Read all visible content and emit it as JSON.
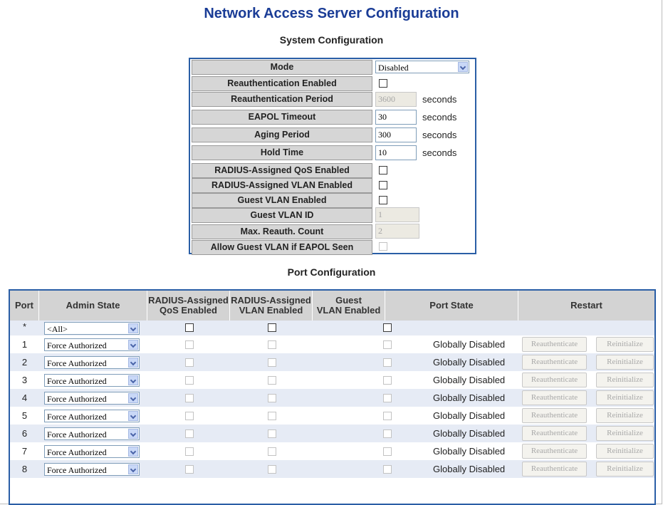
{
  "page_title": "Network Access Server Configuration",
  "system": {
    "title": "System Configuration",
    "rows": [
      {
        "label": "Mode",
        "value": "Disabled"
      },
      {
        "label": "Reauthentication Enabled"
      },
      {
        "label": "Reauthentication Period",
        "value": "3600",
        "unit": "seconds"
      },
      {
        "label": "EAPOL Timeout",
        "value": "30",
        "unit": "seconds"
      },
      {
        "label": "Aging Period",
        "value": "300",
        "unit": "seconds"
      },
      {
        "label": "Hold Time",
        "value": "10",
        "unit": "seconds"
      },
      {
        "label": "RADIUS-Assigned QoS Enabled"
      },
      {
        "label": "RADIUS-Assigned VLAN Enabled"
      },
      {
        "label": "Guest VLAN Enabled"
      },
      {
        "label": "Guest VLAN ID",
        "value": "1"
      },
      {
        "label": "Max. Reauth. Count",
        "value": "2"
      },
      {
        "label": "Allow Guest VLAN if EAPOL Seen"
      }
    ]
  },
  "port": {
    "title": "Port Configuration",
    "headers": {
      "port": "Port",
      "admin": "Admin State",
      "qos_1": "RADIUS-Assigned",
      "qos_2": "QoS Enabled",
      "vlan_1": "RADIUS-Assigned",
      "vlan_2": "VLAN Enabled",
      "guest_1": "Guest",
      "guest_2": "VLAN Enabled",
      "state": "Port State",
      "restart": "Restart"
    },
    "all_row": {
      "port": "*",
      "admin": "<All>"
    },
    "rows": [
      {
        "port": "1",
        "admin": "Force Authorized",
        "state": "Globally Disabled",
        "reauth": "Reauthenticate",
        "reinit": "Reinitialize"
      },
      {
        "port": "2",
        "admin": "Force Authorized",
        "state": "Globally Disabled",
        "reauth": "Reauthenticate",
        "reinit": "Reinitialize"
      },
      {
        "port": "3",
        "admin": "Force Authorized",
        "state": "Globally Disabled",
        "reauth": "Reauthenticate",
        "reinit": "Reinitialize"
      },
      {
        "port": "4",
        "admin": "Force Authorized",
        "state": "Globally Disabled",
        "reauth": "Reauthenticate",
        "reinit": "Reinitialize"
      },
      {
        "port": "5",
        "admin": "Force Authorized",
        "state": "Globally Disabled",
        "reauth": "Reauthenticate",
        "reinit": "Reinitialize"
      },
      {
        "port": "6",
        "admin": "Force Authorized",
        "state": "Globally Disabled",
        "reauth": "Reauthenticate",
        "reinit": "Reinitialize"
      },
      {
        "port": "7",
        "admin": "Force Authorized",
        "state": "Globally Disabled",
        "reauth": "Reauthenticate",
        "reinit": "Reinitialize"
      },
      {
        "port": "8",
        "admin": "Force Authorized",
        "state": "Globally Disabled",
        "reauth": "Reauthenticate",
        "reinit": "Reinitialize"
      }
    ]
  },
  "colors": {
    "title": "#1a3c96",
    "table_border": "#2a5ea6",
    "header_bg": "#d3d3d3",
    "alt_row": "#e6ebf5"
  }
}
